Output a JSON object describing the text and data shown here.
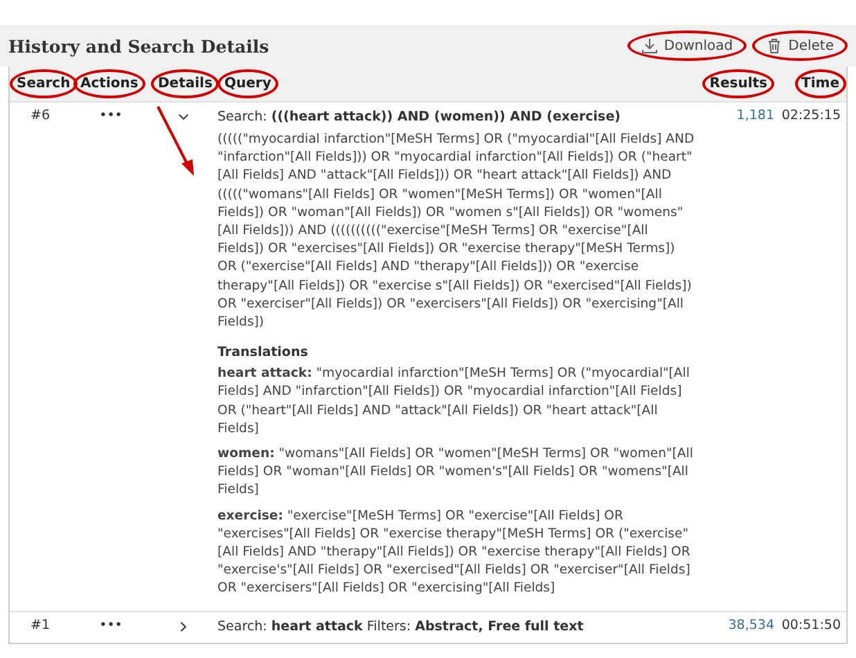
{
  "title": "History and Search Details",
  "toolbar_buttons": [
    {
      "label": "Download",
      "kind": "download",
      "circled": true
    },
    {
      "label": "Delete",
      "kind": "delete",
      "circled": true
    }
  ],
  "columns": [
    {
      "label": "Search",
      "circled": true
    },
    {
      "label": "Actions",
      "circled": true
    },
    {
      "label": "Details",
      "circled": true
    },
    {
      "label": "Query",
      "circled": true
    },
    {
      "label": "Results",
      "circled": true
    },
    {
      "label": "Time",
      "circled": true
    }
  ],
  "annotation_arrow": true,
  "rows": [
    {
      "search": "#6",
      "actions": "•••",
      "expanded": true,
      "query": "Search: **(((heart attack)) AND (women)) AND (exercise)**",
      "details": "(((((\"myocardial infarction\"[MeSH Terms] OR (\"myocardial\"[All Fields] AND \"infarction\"[All Fields])) OR \"myocardial infarction\"[All Fields]) OR (\"heart\"[All Fields] AND \"attack\"[All Fields])) OR \"heart attack\"[All Fields]) AND (((((\"womans\"[All Fields] OR \"women\"[MeSH Terms]) OR \"women\"[All Fields]) OR \"woman\"[All Fields]) OR \"women s\"[All Fields]) OR \"womens\"[All Fields])) AND ((((((((((\"exercise\"[MeSH Terms] OR \"exercise\"[All Fields]) OR \"exercises\"[All Fields]) OR \"exercise therapy\"[MeSH Terms]) OR (\"exercise\"[All Fields] AND \"therapy\"[All Fields])) OR \"exercise therapy\"[All Fields]) OR \"exercise s\"[All Fields]) OR \"exercised\"[All Fields]) OR \"exerciser\"[All Fields]) OR \"exercisers\"[All Fields]) OR \"exercising\"[All Fields])",
      "translations_title": "Translations",
      "translations": [
        "**heart attack:** \"myocardial infarction\"[MeSH Terms] OR (\"myocardial\"[All Fields] AND \"infarction\"[All Fields]) OR \"myocardial infarction\"[All Fields] OR (\"heart\"[All Fields] AND \"attack\"[All Fields]) OR \"heart attack\"[All Fields]",
        "**women:** \"womans\"[All Fields] OR \"women\"[MeSH Terms] OR \"women\"[All Fields] OR \"woman\"[All Fields] OR \"women's\"[All Fields] OR \"womens\"[All Fields]",
        "**exercise:** \"exercise\"[MeSH Terms] OR \"exercise\"[All Fields] OR \"exercises\"[All Fields] OR \"exercise therapy\"[MeSH Terms] OR (\"exercise\"[All Fields] AND \"therapy\"[All Fields]) OR \"exercise therapy\"[All Fields] OR \"exercise's\"[All Fields] OR \"exercised\"[All Fields] OR \"exerciser\"[All Fields] OR \"exercisers\"[All Fields] OR \"exercising\"[All Fields]"
      ],
      "results": "1,181",
      "time": "02:25:15"
    },
    {
      "search": "#1",
      "actions": "•••",
      "expanded": false,
      "query": "Search: **heart attack** Filters: **Abstract, Free full text**",
      "results": "38,534",
      "time": "00:51:50"
    }
  ]
}
